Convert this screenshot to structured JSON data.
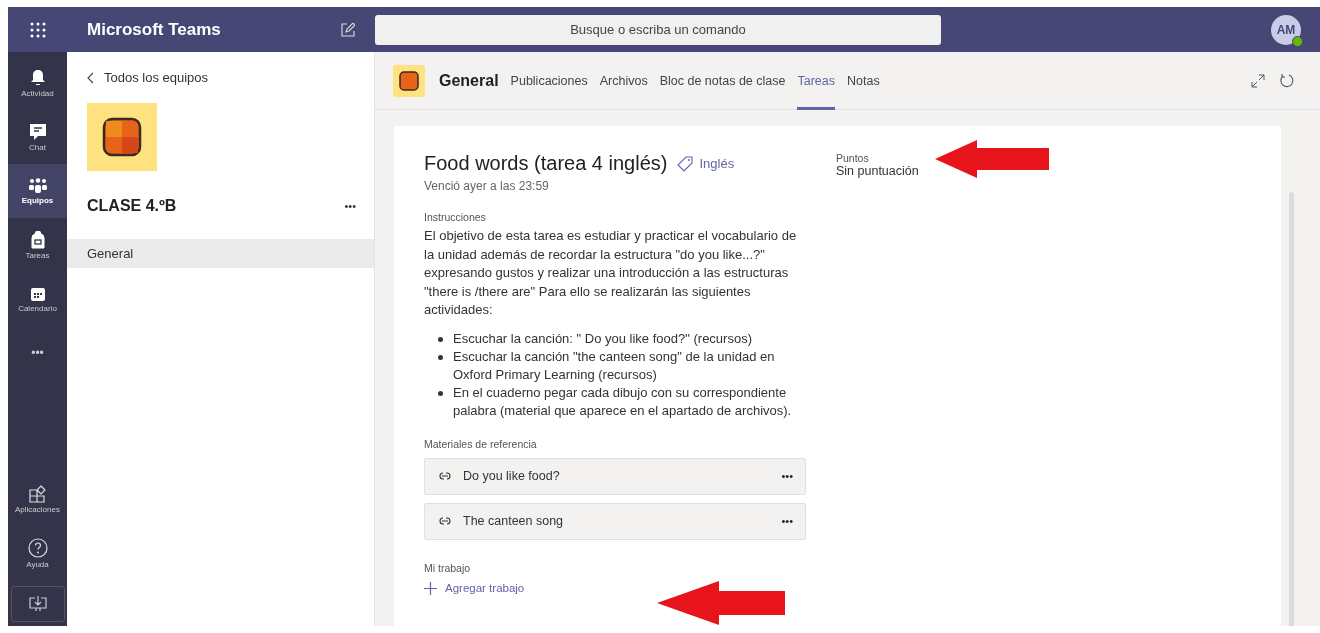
{
  "app": {
    "title": "Microsoft Teams",
    "search": {
      "placeholder": "Busque o escriba un comando"
    },
    "avatar": {
      "initials": "AM",
      "online": true
    }
  },
  "rail": {
    "items": [
      {
        "kind": "bell",
        "label": "Actividad",
        "selected": false
      },
      {
        "kind": "chat",
        "label": "Chat",
        "selected": false
      },
      {
        "kind": "teams",
        "label": "Equipos",
        "selected": true
      },
      {
        "kind": "bag",
        "label": "Tareas",
        "selected": false
      },
      {
        "kind": "calendar",
        "label": "Calendario",
        "selected": false
      },
      {
        "kind": "more",
        "label": "•••",
        "selected": false
      }
    ],
    "bottom": [
      {
        "kind": "apps",
        "label": "Aplicaciones"
      },
      {
        "kind": "help",
        "label": "Ayuda"
      },
      {
        "kind": "download"
      }
    ]
  },
  "team_panel": {
    "back": "Todos los equipos",
    "team_name": "CLASE 4.ºB",
    "more": "•••",
    "channels": [
      {
        "name": "General",
        "selected": true
      }
    ]
  },
  "header": {
    "channel": "General",
    "tabs": [
      {
        "label": "Publicaciones",
        "selected": false
      },
      {
        "label": "Archivos",
        "selected": false
      },
      {
        "label": "Bloc de notas de clase",
        "selected": false
      },
      {
        "label": "Tareas",
        "selected": true
      },
      {
        "label": "Notas",
        "selected": false
      }
    ]
  },
  "assignment": {
    "title": "Food words (tarea 4 inglés)",
    "tag": "Inglés",
    "due": "Venció ayer a las 23:59",
    "instructions_label": "Instrucciones",
    "instructions": "El objetivo de esta tarea es estudiar y practicar el vocabulario de la unidad además de recordar la estructura \"do you like...?\" expresando gustos y realizar una introducción a las estructuras \"there is /there are\" Para ello se realizarán las siguientes actividades:",
    "activities": [
      "Escuchar la canción: \" Do you like food?\" (recursos)",
      "Escuchar la canción \"the canteen song\" de la unidad en Oxford Primary Learning (recursos)",
      "En el cuaderno pegar cada dibujo con su correspondiente palabra (material que aparece en el apartado de archivos)."
    ],
    "materials_label": "Materiales de referencia",
    "materials": [
      {
        "name": "Do you like food?",
        "more": "•••"
      },
      {
        "name": "The canteen song",
        "more": "•••"
      }
    ],
    "work_label": "Mi trabajo",
    "add_work": "Agregar trabajo",
    "points_label": "Puntos",
    "points": "Sin puntuación"
  }
}
